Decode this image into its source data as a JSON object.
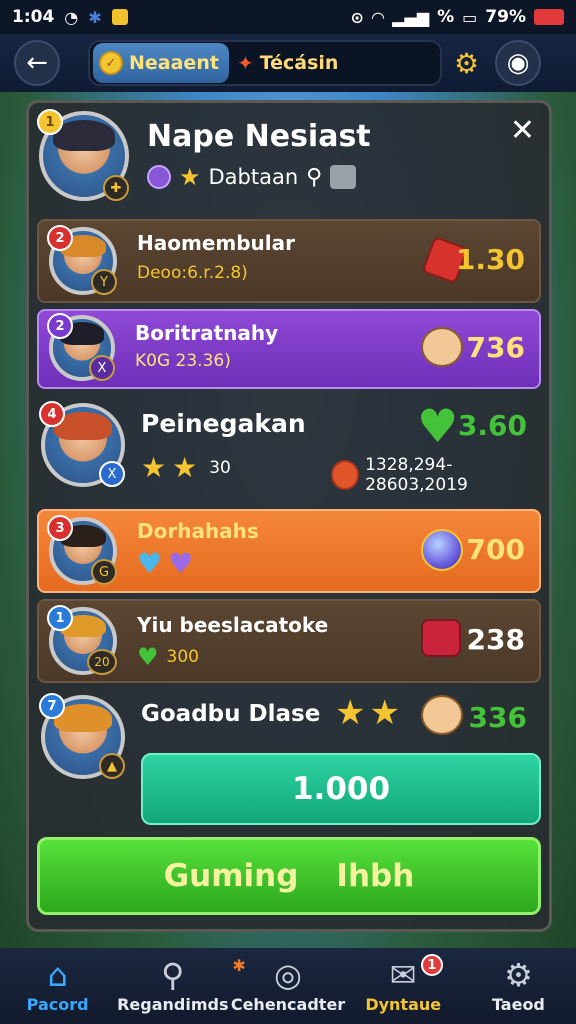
{
  "status": {
    "time": "1:04",
    "battery": "79%",
    "percent_small": "%"
  },
  "topbar": {
    "currency1": "Neaaent",
    "currency2": "Técásin"
  },
  "header": {
    "name": "Nape Nesiast",
    "subtitle": "Dabtaan",
    "level_badge": "1"
  },
  "rows": [
    {
      "rank": "2",
      "name": "Haomembular",
      "sub": "Deoo:6.r.2.8)",
      "score": "1.30",
      "badge": "Y"
    },
    {
      "rank": "2",
      "name": "Boritratnahy",
      "sub": "K0G 23.36)",
      "score": "736",
      "badge": "X"
    },
    {
      "rank": "4",
      "name": "Peinegakan",
      "sub_count": "30",
      "sub_extra": "1328,294-28603,2019",
      "score": "3.60",
      "badge": "X"
    },
    {
      "rank": "3",
      "name": "Dorhahahs",
      "score": "700",
      "badge": "G"
    },
    {
      "rank": "1",
      "name": "Yiu beeslacatoke",
      "sub_badge": "20",
      "sub_count": "300",
      "score": "238"
    },
    {
      "rank": "7",
      "name": "Goadbu Dlase",
      "score": "336"
    }
  ],
  "buttons": {
    "teal": "1.000",
    "green_left": "Guming",
    "green_right": "Ihbh"
  },
  "nav": [
    {
      "label": "Pacord",
      "icon": "home-icon"
    },
    {
      "label": "Regandimds",
      "icon": "search-icon"
    },
    {
      "label": "Cehencadter",
      "icon": "globe-icon"
    },
    {
      "label": "Dyntaue",
      "icon": "chat-icon",
      "badge": "1"
    },
    {
      "label": "Taeod",
      "icon": "gear-icon"
    }
  ],
  "colors": {
    "accent_blue": "#3aa7ff",
    "gold": "#f4c531",
    "green": "#44c23a",
    "purple_row": "#8f49d6",
    "orange_row": "#f5873a"
  }
}
